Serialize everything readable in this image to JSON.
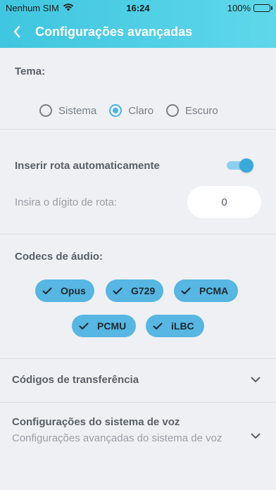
{
  "status_bar": {
    "carrier": "Nenhum SIM",
    "time": "16:24",
    "battery": "100%"
  },
  "nav": {
    "title": "Configurações avançadas"
  },
  "theme": {
    "label": "Tema:",
    "options": [
      "Sistema",
      "Claro",
      "Escuro"
    ],
    "selected": "Claro"
  },
  "route": {
    "auto_label": "Inserir rota automaticamente",
    "auto_enabled": true,
    "digit_label": "Insira o dígito de rota:",
    "digit_value": "0"
  },
  "codecs": {
    "label": "Codecs de áudio:",
    "items": [
      "Opus",
      "G729",
      "PCMA",
      "PCMU",
      "iLBC"
    ]
  },
  "transfer": {
    "label": "Códigos de transferência"
  },
  "voice_system": {
    "title": "Configurações do sistema de voz",
    "subtitle": "Configurações avançadas do sistema de voz"
  },
  "colors": {
    "header": "#3fc6e0",
    "accent": "#4cb4df",
    "chip": "#57b6e2"
  },
  "icons": {
    "back": "chevron-left-icon",
    "wifi": "wifi-icon",
    "battery": "battery-icon",
    "check": "check-icon",
    "chevron": "chevron-down-icon"
  }
}
